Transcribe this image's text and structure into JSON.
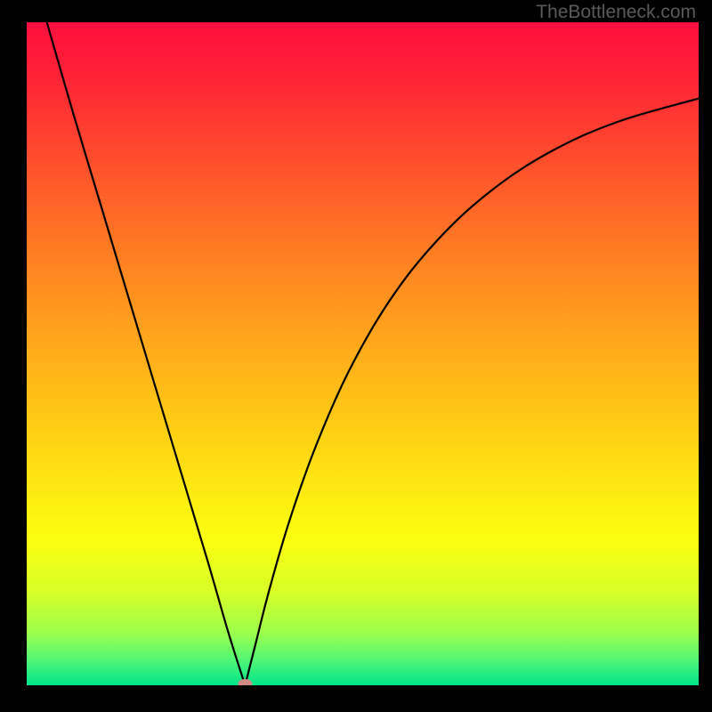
{
  "watermark": "TheBottleneck.com",
  "chart_data": {
    "type": "line",
    "title": "",
    "xlabel": "",
    "ylabel": "",
    "xlim": [
      0,
      100
    ],
    "ylim": [
      0,
      100
    ],
    "background_gradient": {
      "stops": [
        {
          "offset": 0.0,
          "color": "#ff0f3e"
        },
        {
          "offset": 0.08,
          "color": "#ff2236"
        },
        {
          "offset": 0.2,
          "color": "#ff4b2d"
        },
        {
          "offset": 0.35,
          "color": "#ff7e22"
        },
        {
          "offset": 0.5,
          "color": "#ffad1a"
        },
        {
          "offset": 0.65,
          "color": "#ffd912"
        },
        {
          "offset": 0.78,
          "color": "#fbff0f"
        },
        {
          "offset": 0.86,
          "color": "#d7ff27"
        },
        {
          "offset": 0.92,
          "color": "#9dff4a"
        },
        {
          "offset": 0.96,
          "color": "#55f774"
        },
        {
          "offset": 1.0,
          "color": "#00e58b"
        }
      ]
    },
    "curve": {
      "minimum_x": 32.5,
      "left_branch": [
        {
          "x": 3.0,
          "y": 100.0
        },
        {
          "x": 7.0,
          "y": 86.0
        },
        {
          "x": 11.0,
          "y": 72.5
        },
        {
          "x": 15.0,
          "y": 59.0
        },
        {
          "x": 19.0,
          "y": 45.5
        },
        {
          "x": 23.0,
          "y": 32.0
        },
        {
          "x": 27.0,
          "y": 18.5
        },
        {
          "x": 30.0,
          "y": 8.0
        },
        {
          "x": 32.5,
          "y": 0.0
        }
      ],
      "right_branch": [
        {
          "x": 32.5,
          "y": 0.0
        },
        {
          "x": 34.0,
          "y": 6.0
        },
        {
          "x": 36.0,
          "y": 14.0
        },
        {
          "x": 39.0,
          "y": 24.5
        },
        {
          "x": 43.0,
          "y": 36.0
        },
        {
          "x": 48.0,
          "y": 47.5
        },
        {
          "x": 54.0,
          "y": 58.0
        },
        {
          "x": 61.0,
          "y": 67.0
        },
        {
          "x": 69.0,
          "y": 74.5
        },
        {
          "x": 78.0,
          "y": 80.5
        },
        {
          "x": 88.0,
          "y": 85.0
        },
        {
          "x": 100.0,
          "y": 88.5
        }
      ]
    },
    "marker": {
      "x": 32.5,
      "y": 0.0,
      "color": "#d08a86",
      "rx": 8,
      "ry": 5
    }
  }
}
